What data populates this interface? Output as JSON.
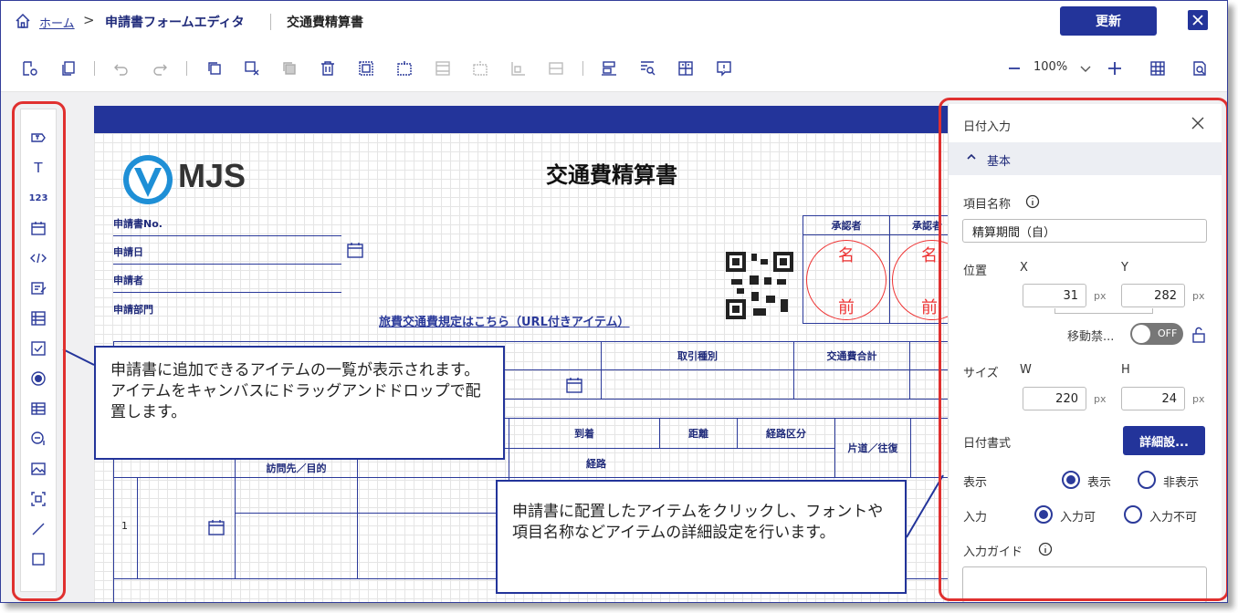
{
  "breadcrumb": {
    "home": "ホーム",
    "separator": ">",
    "editor": "申請書フォームエディタ",
    "document": "交通費精算書"
  },
  "header": {
    "update_label": "更新"
  },
  "toolbar": {
    "zoom": "100%"
  },
  "palette": {
    "items": [
      "textbox-icon",
      "text-icon",
      "number-icon",
      "calendar-icon",
      "code-icon",
      "memo-icon",
      "list-icon",
      "checkbox-icon",
      "radio-icon",
      "table-icon",
      "approval-icon",
      "image-icon",
      "qr-icon",
      "line-icon",
      "rectangle-icon"
    ],
    "number_text": "123",
    "text_glyph": "T"
  },
  "canvas": {
    "logo_text": "MJS",
    "title": "交通費精算書",
    "fields": {
      "no": "申請書No.",
      "date": "申請日",
      "applicant": "申請者",
      "dept": "申請部門"
    },
    "url_link": "旅費交通費規定はこちら（URL付きアイテム）",
    "approver_header": "承認者",
    "approver_header_2": "承認者",
    "stamp_top": "名",
    "stamp_bottom": "前",
    "table": {
      "transaction_type": "取引種別",
      "total": "交通費合計",
      "arrival": "到着",
      "distance": "距離",
      "route_type": "経路区分",
      "oneway": "片道／往復",
      "route": "経路",
      "visit": "訪問先／目的",
      "row_no": "1"
    }
  },
  "callouts": {
    "left": "申請書に追加できるアイテムの一覧が表示されます。アイテムをキャンバスにドラッグアンドドロップで配置します。",
    "right": "申請書に配置したアイテムをクリックし、フォントや項目名称などアイテムの詳細設定を行います。"
  },
  "props": {
    "title": "日付入力",
    "section": "基本",
    "item_name_label": "項目名称",
    "item_name_value": "精算期間（自）",
    "position_label": "位置",
    "x_label": "X",
    "y_label": "Y",
    "x_value": "31",
    "y_value": "282",
    "unit": "px",
    "lock_label": "移動禁...",
    "toggle": "OFF",
    "size_label": "サイズ",
    "w_label": "W",
    "h_label": "H",
    "w_value": "220",
    "h_value": "24",
    "date_format_label": "日付書式",
    "detail_button": "詳細設...",
    "display_label": "表示",
    "show": "表示",
    "hide": "非表示",
    "input_label": "入力",
    "input_ok": "入力可",
    "input_ng": "入力不可",
    "guide_label": "入力ガイド"
  },
  "colors": {
    "brand": "#23349a",
    "highlight": "#e0302f",
    "stamp": "#e33"
  }
}
